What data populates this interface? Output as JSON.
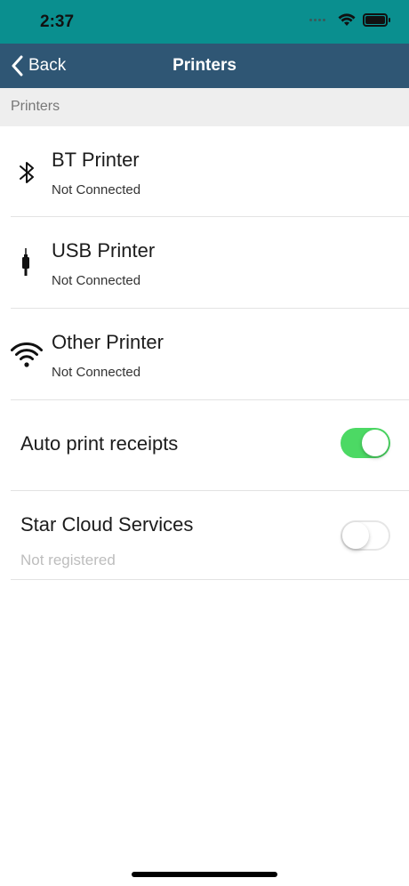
{
  "status_bar": {
    "time": "2:37"
  },
  "nav": {
    "back_label": "Back",
    "title": "Printers"
  },
  "section": {
    "header": "Printers"
  },
  "printers": [
    {
      "name": "BT Printer",
      "status": "Not Connected",
      "icon": "bluetooth-icon"
    },
    {
      "name": "USB Printer",
      "status": "Not Connected",
      "icon": "usb-cable-icon"
    },
    {
      "name": "Other Printer",
      "status": "Not Connected",
      "icon": "wifi-icon"
    }
  ],
  "settings": {
    "auto_print": {
      "label": "Auto print receipts",
      "enabled": true
    },
    "star_cloud": {
      "label": "Star Cloud Services",
      "sub": "Not registered",
      "enabled": false
    }
  },
  "colors": {
    "status_bar": "#0a8f8f",
    "nav_bar": "#2f5674",
    "toggle_on": "#4cd964"
  }
}
